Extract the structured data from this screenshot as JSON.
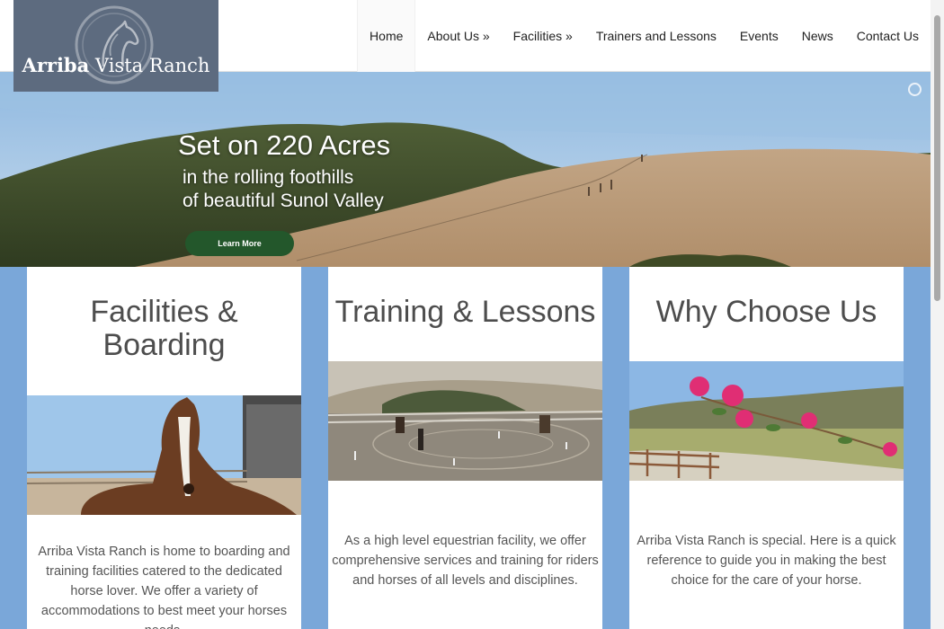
{
  "logo": {
    "bold": "Arriba",
    "rest": " Vista Ranch"
  },
  "nav": {
    "items": [
      "Home",
      "About Us »",
      "Facilities »",
      "Trainers and Lessons",
      "Events",
      "News",
      "Contact Us"
    ]
  },
  "hero": {
    "title": "Set on 220 Acres",
    "line1": "in the rolling foothills",
    "line2": "of beautiful Sunol Valley",
    "button": "Learn More"
  },
  "columns": [
    {
      "title_line1": "Facilities &",
      "title_line2": "Boarding",
      "text": "Arriba Vista Ranch is home to boarding and training facilities catered to the dedicated horse lover. We offer a variety of accommodations to best meet your horses needs."
    },
    {
      "title": "Training & Lessons",
      "text": "As a high level equestrian facility, we offer comprehensive services and training for riders and horses of all levels and disciplines."
    },
    {
      "title": "Why Choose Us",
      "text": "Arriba Vista Ranch is special. Here is a quick reference to guide you in making the best choice for the care of your horse."
    }
  ],
  "icons": {
    "logo": "horse-head-icon",
    "slider": "slider-dot-icon"
  },
  "colors": {
    "page_background": "#7aa7d9",
    "logo_background": "#5d6b7f",
    "button": "#23572b"
  }
}
